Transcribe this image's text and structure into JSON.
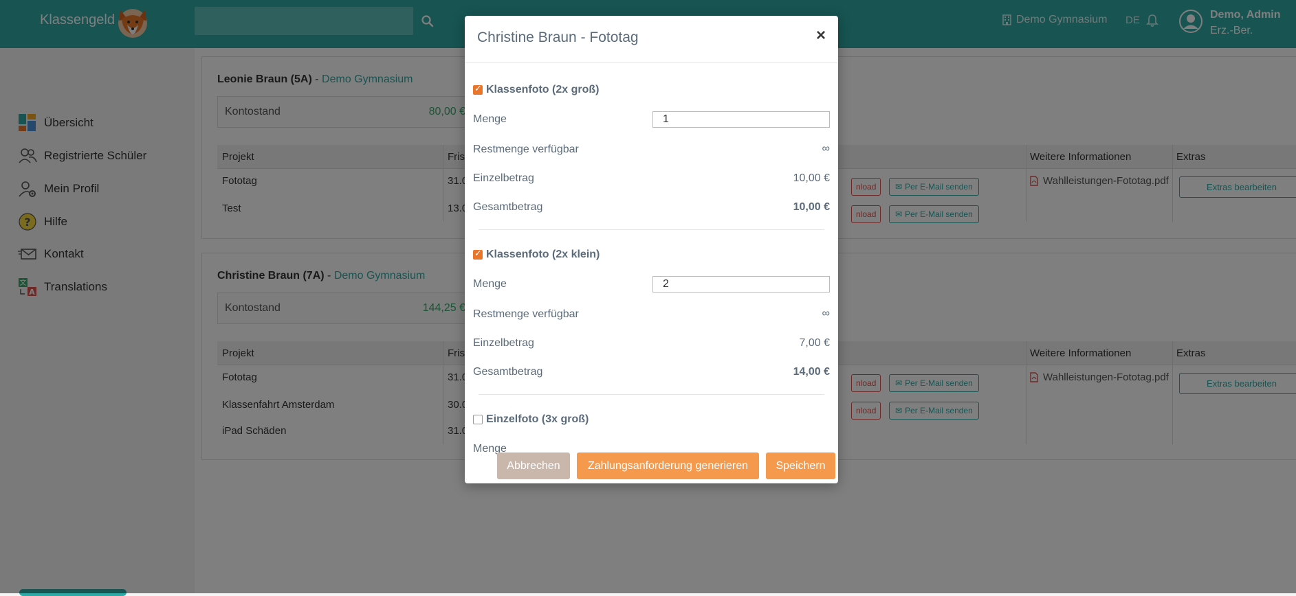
{
  "header": {
    "brand": "Klassengeld",
    "school": "Demo Gymnasium",
    "lang": "DE",
    "user_name": "Demo, Admin",
    "user_role": "Erz.-Ber."
  },
  "sidebar": {
    "items": [
      {
        "label": "Übersicht",
        "icon": "dashboard-icon"
      },
      {
        "label": "Registrierte Schüler",
        "icon": "users-icon"
      },
      {
        "label": "Mein Profil",
        "icon": "profile-gear-icon"
      },
      {
        "label": "Hilfe",
        "icon": "help-icon"
      },
      {
        "label": "Kontakt",
        "icon": "mail-icon"
      },
      {
        "label": "Translations",
        "icon": "translate-icon"
      }
    ]
  },
  "students": [
    {
      "name": "Leonie Braun (5A)",
      "school": "Demo Gymnasium",
      "balance_label": "Kontostand",
      "balance": "80,00 €",
      "columns": {
        "project": "Projekt",
        "deadline": "Fris",
        "info": "Weitere Informationen",
        "extras": "Extras"
      },
      "rows": [
        {
          "project": "Fototag",
          "deadline": "31.0",
          "download": "nload",
          "mail": "Per E-Mail senden",
          "pdf": "Wahlleistungen-Fototag.pdf",
          "extras": "Extras bearbeiten"
        },
        {
          "project": "Test",
          "deadline": "13.0",
          "download": "nload",
          "mail": "Per E-Mail senden"
        }
      ]
    },
    {
      "name": "Christine Braun (7A)",
      "school": "Demo Gymnasium",
      "balance_label": "Kontostand",
      "balance": "144,25 €",
      "columns": {
        "project": "Projekt",
        "deadline": "Fris",
        "info": "Weitere Informationen",
        "extras": "Extras"
      },
      "rows": [
        {
          "project": "Fototag",
          "deadline": "31.0",
          "download": "nload",
          "mail": "Per E-Mail senden",
          "pdf": "Wahlleistungen-Fototag.pdf",
          "extras": "Extras bearbeiten"
        },
        {
          "project": "Klassenfahrt Amsterdam",
          "deadline": "30.0",
          "download": "nload",
          "mail": "Per E-Mail senden"
        },
        {
          "project": "iPad Schäden",
          "deadline": "31.0"
        }
      ]
    }
  ],
  "modal": {
    "title": "Christine Braun - Fototag",
    "close": "×",
    "options": [
      {
        "title": "Klassenfoto (2x groß)",
        "checked": true,
        "menge_label": "Menge",
        "menge": "1",
        "rest_label": "Restmenge verfügbar",
        "rest": "∞",
        "einzel_label": "Einzelbetrag",
        "einzel": "10,00 €",
        "gesamt_label": "Gesamtbetrag",
        "gesamt": "10,00 €"
      },
      {
        "title": "Klassenfoto (2x klein)",
        "checked": true,
        "menge_label": "Menge",
        "menge": "2",
        "rest_label": "Restmenge verfügbar",
        "rest": "∞",
        "einzel_label": "Einzelbetrag",
        "einzel": "7,00 €",
        "gesamt_label": "Gesamtbetrag",
        "gesamt": "14,00 €"
      },
      {
        "title": "Einzelfoto (3x groß)",
        "checked": false,
        "menge_label": "Menge"
      }
    ],
    "buttons": {
      "cancel": "Abbrechen",
      "generate": "Zahlungsanforderung generieren",
      "save": "Speichern"
    }
  },
  "colors": {
    "teal": "#2ea9a5",
    "orange": "#f59a4c",
    "checkbox": "#e9762b",
    "balance_green": "#3aa86b",
    "danger": "#d9534f"
  }
}
